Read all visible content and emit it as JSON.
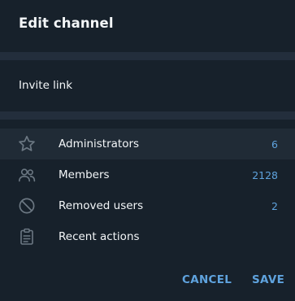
{
  "dialog": {
    "title": "Edit channel",
    "invite_link_label": "Invite link",
    "items": [
      {
        "icon": "star-icon",
        "label": "Administrators",
        "count": "6"
      },
      {
        "icon": "members-icon",
        "label": "Members",
        "count": "2128"
      },
      {
        "icon": "blocked-icon",
        "label": "Removed users",
        "count": "2"
      },
      {
        "icon": "clipboard-icon",
        "label": "Recent actions",
        "count": ""
      }
    ],
    "cancel_label": "CANCEL",
    "save_label": "SAVE"
  },
  "colors": {
    "background": "#17212b",
    "divider": "#232e3c",
    "highlight": "#202b36",
    "text": "#f3f6f8",
    "accent": "#5fa3de",
    "icon": "#6c7883"
  }
}
